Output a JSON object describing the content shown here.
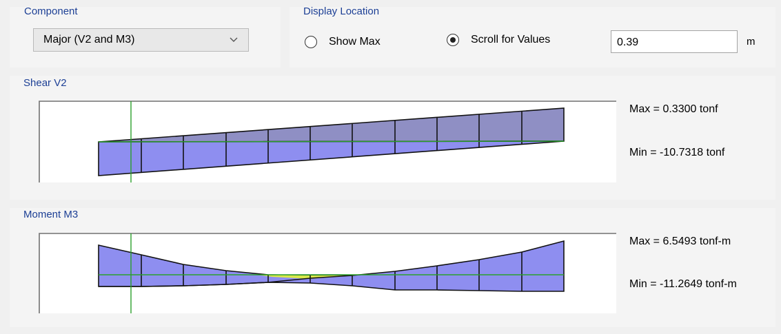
{
  "component": {
    "title": "Component",
    "selected": "Major (V2 and M3)"
  },
  "display_location": {
    "title": "Display Location",
    "options": [
      "Show Max",
      "Scroll for Values"
    ],
    "selected_index": 1,
    "value": "0.39",
    "unit": "m"
  },
  "shear": {
    "title": "Shear V2",
    "max_label": "Max = 0.3300 tonf",
    "min_label": "Min = -10.7318 tonf"
  },
  "moment": {
    "title": "Moment M3",
    "max_label": "Max = 6.5493 tonf-m",
    "min_label": "Min = -11.2649 tonf-m"
  },
  "colors": {
    "fill": "#8e8ef0",
    "fill_dark": "#8f8fc4",
    "axis": "#2aa02a",
    "zero_fill": "#d8e84a",
    "group_title": "#1c3f95"
  }
}
